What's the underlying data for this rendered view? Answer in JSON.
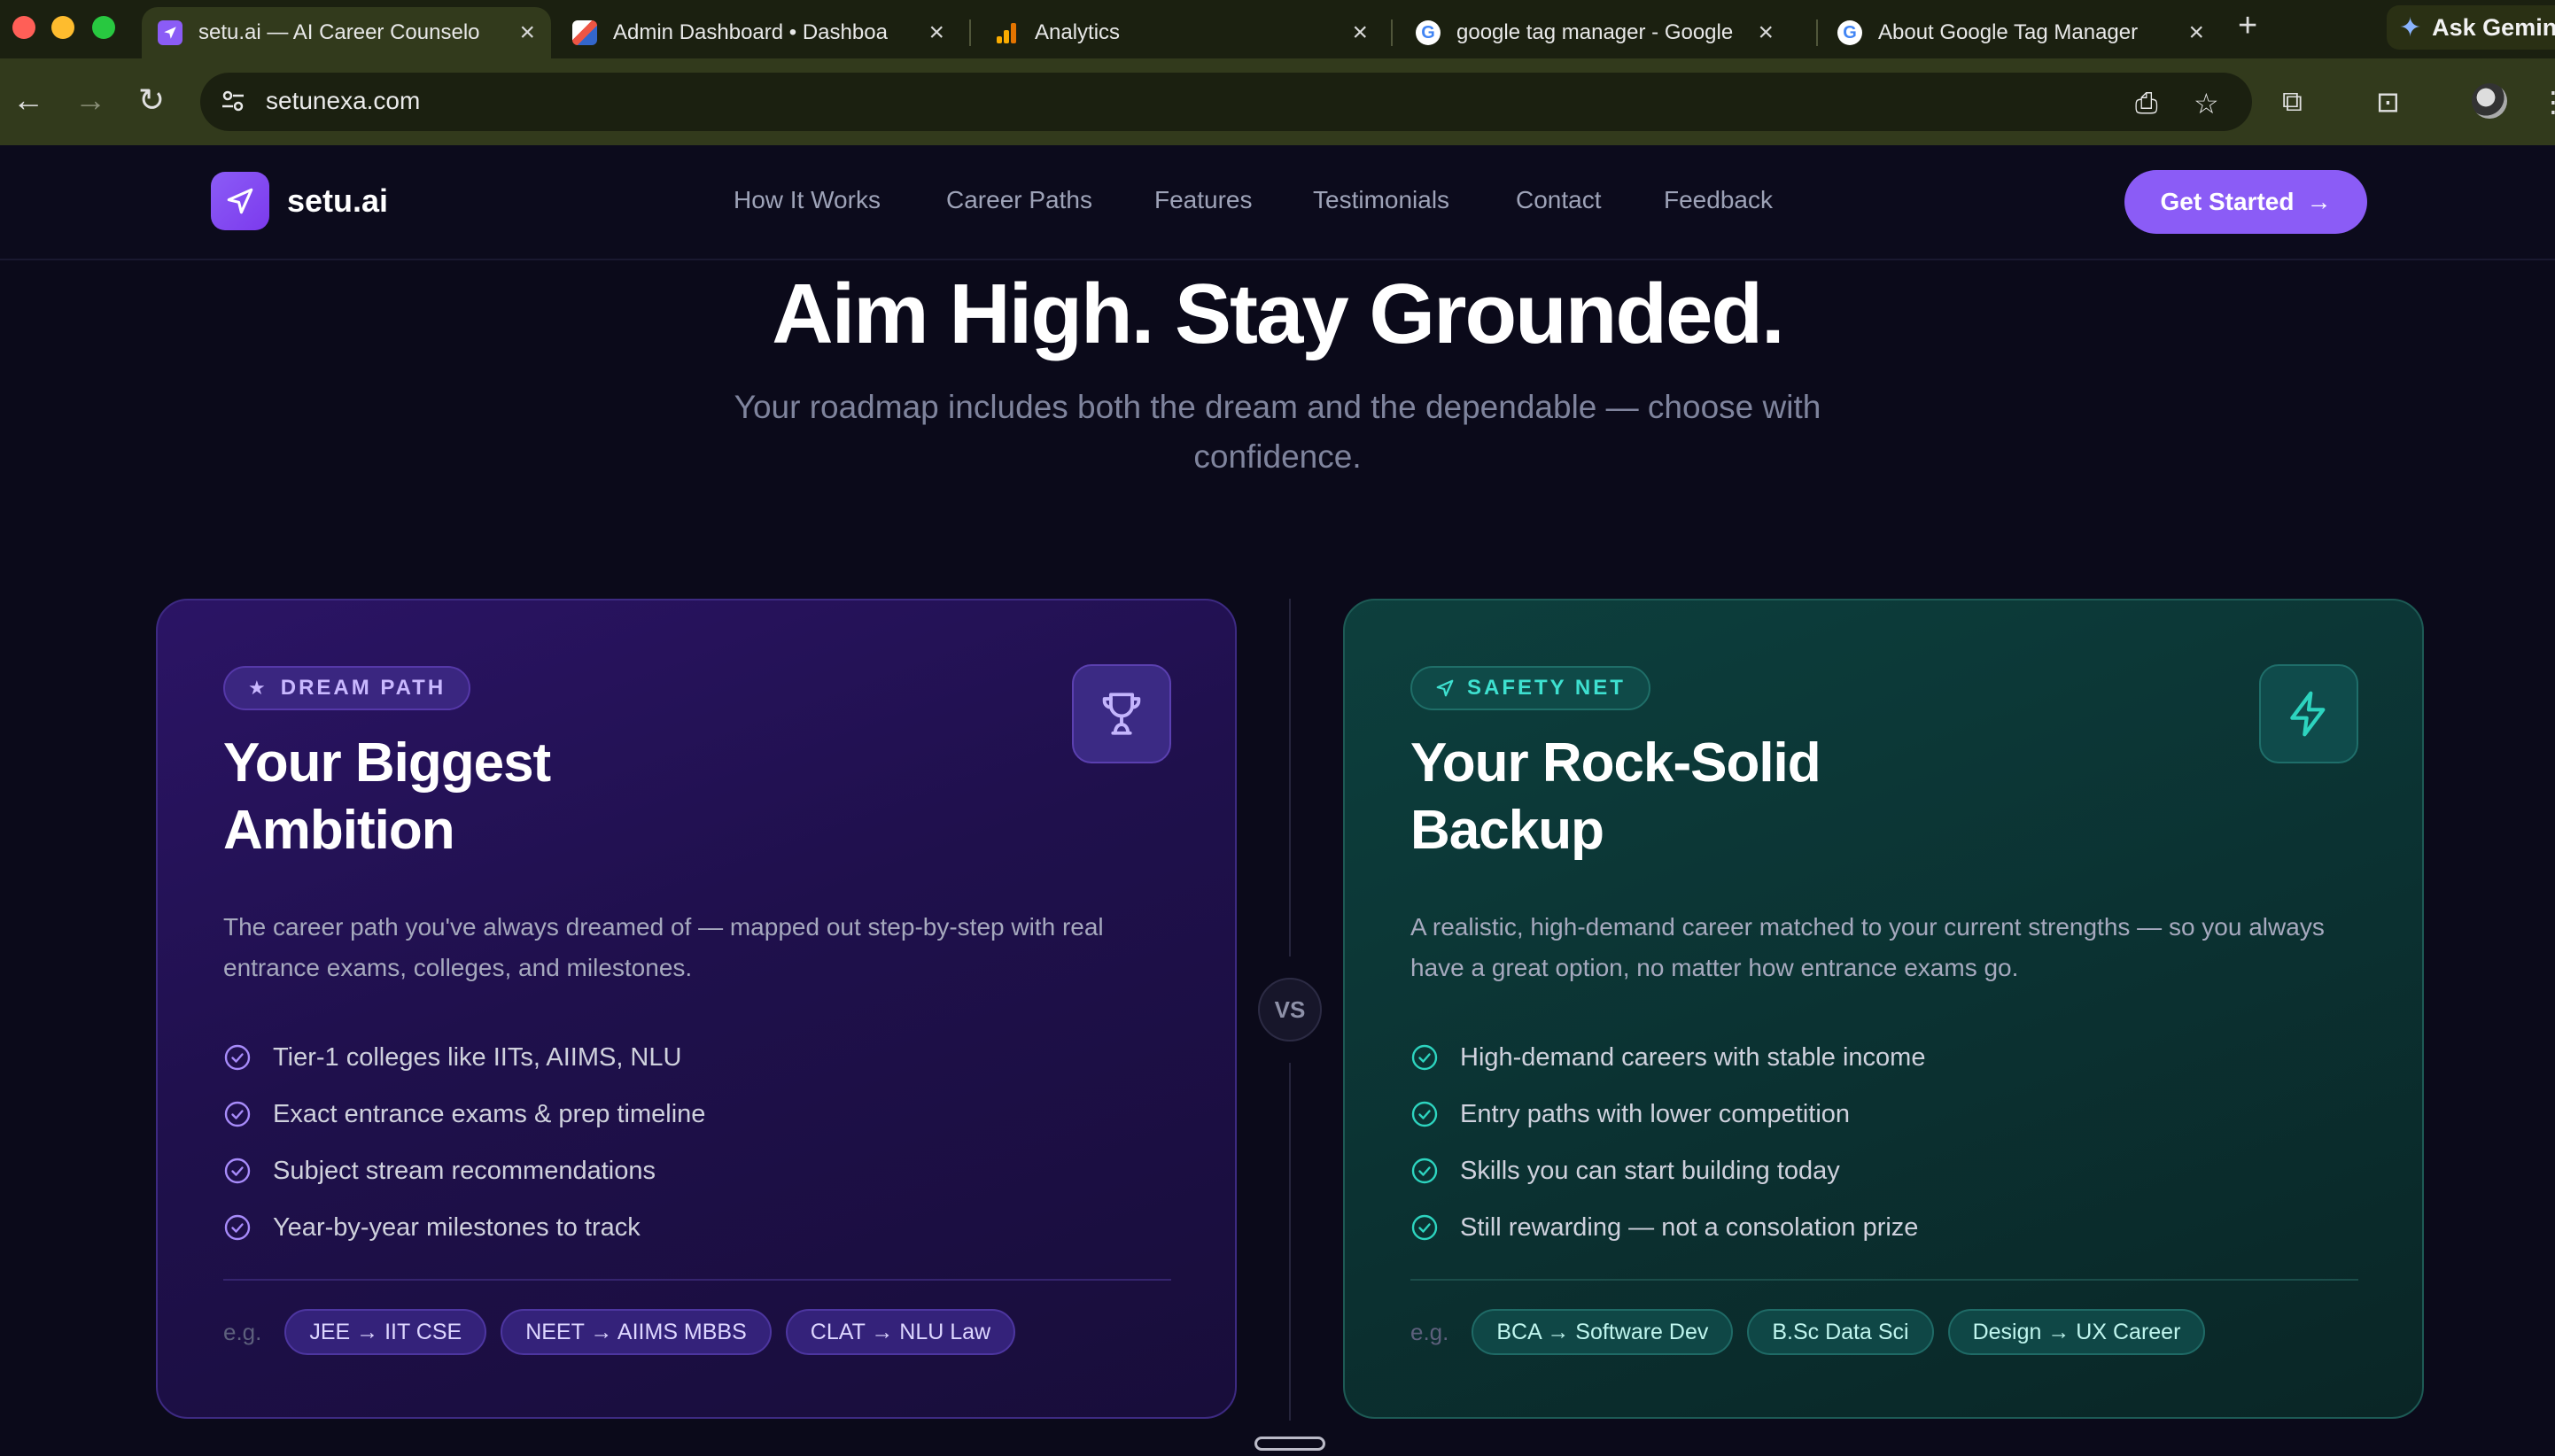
{
  "browser": {
    "tabs": [
      {
        "title": "setu.ai — AI Career Counselo",
        "active": true
      },
      {
        "title": "Admin Dashboard • Dashboa"
      },
      {
        "title": "Analytics"
      },
      {
        "title": "google tag manager - Google"
      },
      {
        "title": "About Google Tag Manager"
      }
    ],
    "new_tab": "+",
    "ask_gemini": "Ask Gemini",
    "url": "setunexa.com"
  },
  "nav": {
    "brand": "setu.ai",
    "links": [
      "How It Works",
      "Career Paths",
      "Features",
      "Testimonials",
      "Contact",
      "Feedback"
    ],
    "cta": "Get Started"
  },
  "hero": {
    "title": "Aim High. Stay Grounded.",
    "subtitle": "Your roadmap includes both the dream and the dependable — choose with confidence."
  },
  "vs_label": "VS",
  "cards": {
    "dream": {
      "badge": "DREAM PATH",
      "title_line1": "Your Biggest",
      "title_line2": "Ambition",
      "description": "The career path you've always dreamed of — mapped out step-by-step with real entrance exams, colleges, and milestones.",
      "bullets": [
        "Tier-1 colleges like IITs, AIIMS, NLU",
        "Exact entrance exams & prep timeline",
        "Subject stream recommendations",
        "Year-by-year milestones to track"
      ],
      "eg_label": "e.g.",
      "examples": [
        "JEE → IIT CSE",
        "NEET → AIIMS MBBS",
        "CLAT → NLU Law"
      ]
    },
    "safety": {
      "badge": "SAFETY NET",
      "title_line1": "Your Rock-Solid",
      "title_line2": "Backup",
      "description": "A realistic, high-demand career matched to your current strengths — so you always have a great option, no matter how entrance exams go.",
      "bullets": [
        "High-demand careers with stable income",
        "Entry paths with lower competition",
        "Skills you can start building today",
        "Still rewarding — not a consolation prize"
      ],
      "eg_label": "e.g.",
      "examples": [
        "BCA → Software Dev",
        "B.Sc Data Sci",
        "Design → UX Career"
      ]
    }
  },
  "colors": {
    "accent": "#8b5cf6",
    "teal": "#2dd4bf",
    "background": "#0b0a1a"
  }
}
